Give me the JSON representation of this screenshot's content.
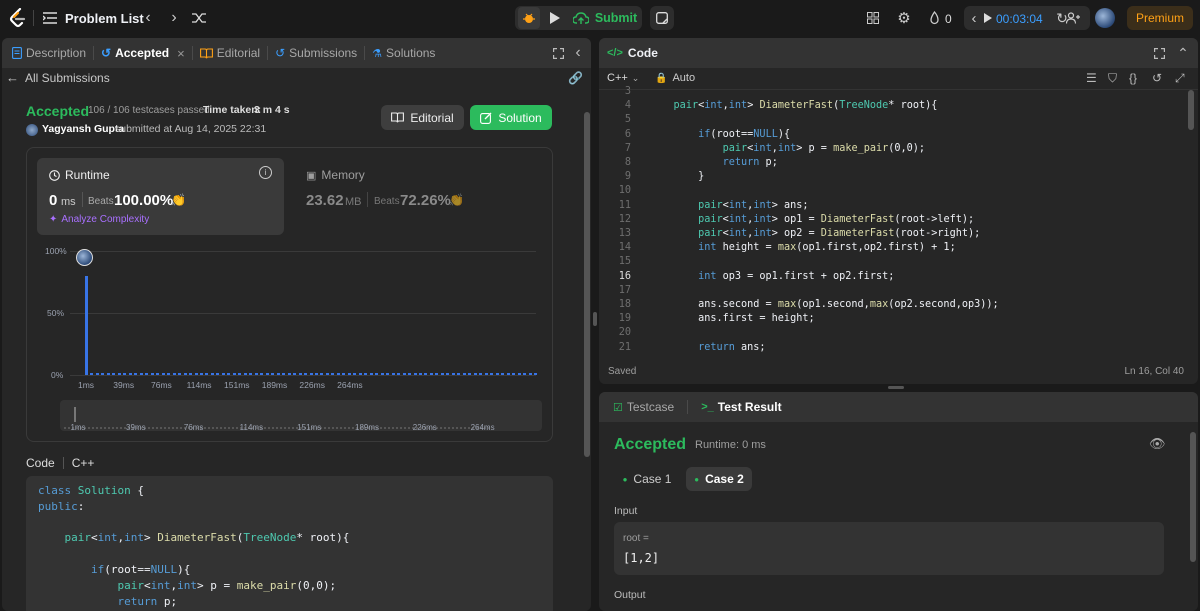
{
  "topbar": {
    "problem_list": "Problem List",
    "submit": "Submit",
    "streak": "0",
    "timer": "00:03:04",
    "premium": "Premium"
  },
  "left": {
    "tabs": [
      "Description",
      "Accepted",
      "Editorial",
      "Submissions",
      "Solutions"
    ],
    "all_submissions": "All Submissions",
    "status": "Accepted",
    "testcases": "106 / 106 testcases passed",
    "time_taken_label": "Time taken:",
    "time_taken": "3 m 4 s",
    "user": "Yagyansh Gupta",
    "submitted_at": "submitted at Aug 14, 2025 22:31",
    "editorial_btn": "Editorial",
    "solution_btn": "Solution",
    "runtime": {
      "label": "Runtime",
      "value": "0",
      "unit": "ms",
      "beats_label": "Beats",
      "beats": "100.00%",
      "analyze": "Analyze Complexity"
    },
    "memory": {
      "label": "Memory",
      "value": "23.62",
      "unit": "MB",
      "beats_label": "Beats",
      "beats": "72.26%"
    },
    "code_label": "Code",
    "code_lang": "C++",
    "code": [
      "class Solution {",
      "public:",
      "",
      "    pair<int,int> DiameterFast(TreeNode* root){",
      "",
      "        if(root==NULL){",
      "            pair<int,int> p = make_pair(0,0);",
      "            return p;"
    ]
  },
  "chart_data": {
    "type": "bar",
    "y_ticks": [
      "100%",
      "50%",
      "0%"
    ],
    "x_ticks": [
      "1ms",
      "39ms",
      "76ms",
      "114ms",
      "151ms",
      "189ms",
      "226ms",
      "264ms"
    ],
    "ylim": [
      0,
      100
    ],
    "values": [
      80,
      1.5,
      1.5,
      1.5,
      1.5,
      1.5,
      1.5,
      1.5,
      1.5,
      1.5,
      1.5,
      1.5,
      1.5,
      1.5,
      1.5,
      1.5,
      1.5,
      1.5,
      1.5,
      1.5,
      1.5,
      1.5,
      1.5,
      1.5,
      1.5,
      1.5,
      1.5,
      1.5,
      1.5,
      1.5,
      1.5,
      1.5,
      1.5,
      1.5,
      1.5,
      1.5,
      1.5,
      1.5,
      1.5,
      1.5,
      1.5,
      1.5,
      1.5,
      1.5,
      1.5,
      1.5,
      1.5,
      1.5,
      1.5,
      1.5,
      1.5,
      1.5,
      1.5,
      1.5,
      1.5,
      1.5,
      1.5,
      1.5,
      1.5,
      1.5,
      1.5,
      1.5,
      1.5,
      1.5,
      1.5,
      1.5,
      1.5,
      1.5,
      1.5,
      1.5,
      1.5,
      1.5,
      1.5,
      1.5,
      1.5,
      1.5,
      1.5,
      1.5,
      1.5,
      1.5,
      1.5,
      1.5,
      1.5
    ],
    "accent": "#3874e6"
  },
  "editor": {
    "title": "Code",
    "lang": "C++",
    "auto": "Auto",
    "saved": "Saved",
    "cursor": "Ln 16, Col 40",
    "start_line": 3,
    "lines": [
      "",
      "    pair<int,int> DiameterFast(TreeNode* root){",
      "",
      "        if(root==NULL){",
      "            pair<int,int> p = make_pair(0,0);",
      "            return p;",
      "        }",
      "",
      "        pair<int,int> ans;",
      "        pair<int,int> op1 = DiameterFast(root->left);",
      "        pair<int,int> op2 = DiameterFast(root->right);",
      "        int height = max(op1.first,op2.first) + 1;",
      "",
      "        int op3 = op1.first + op2.first;",
      "",
      "        ans.second = max(op1.second,max(op2.second,op3));",
      "        ans.first = height;",
      "",
      "        return ans;"
    ]
  },
  "result": {
    "testcase_tab": "Testcase",
    "result_tab": "Test Result",
    "status": "Accepted",
    "runtime": "Runtime: 0 ms",
    "case1": "Case 1",
    "case2": "Case 2",
    "input_label": "Input",
    "var": "root =",
    "value": "[1,2]",
    "output_label": "Output"
  },
  "colors": {
    "accepted": "#2cbb5d",
    "solution_btn": "#2cbb5d",
    "premium": "#ffa116"
  }
}
